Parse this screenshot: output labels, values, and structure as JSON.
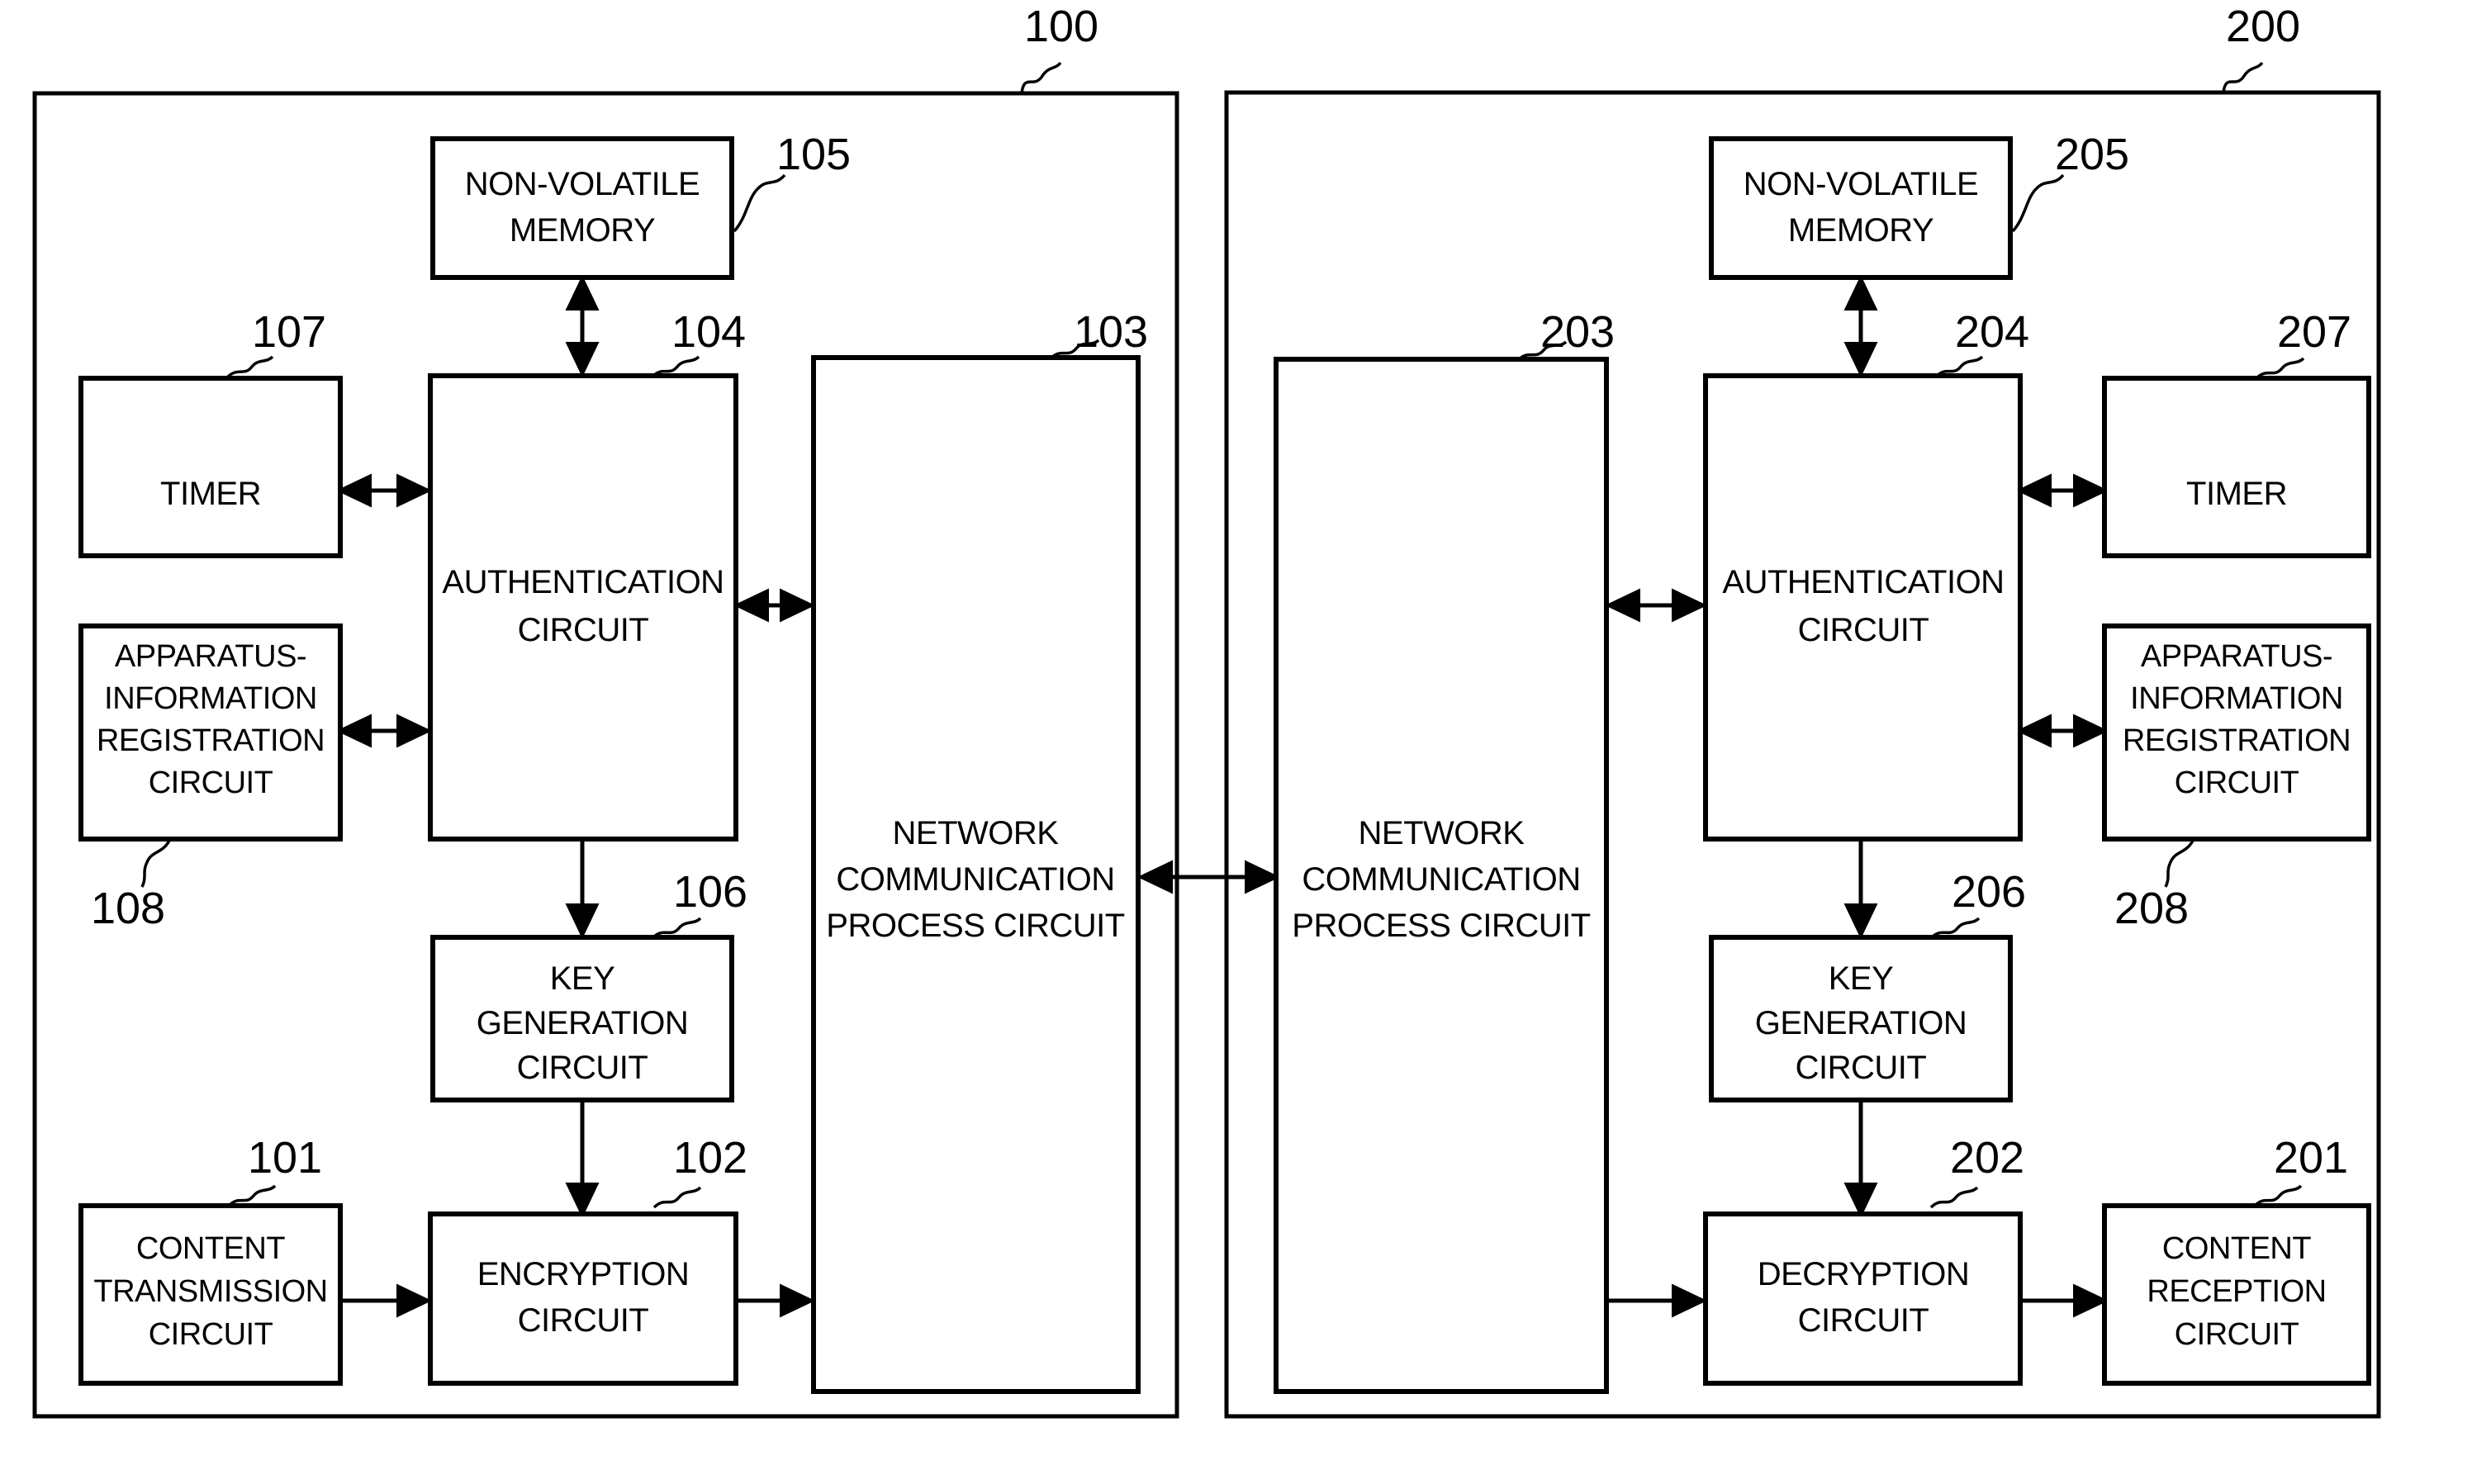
{
  "figure": {
    "type": "patent-block-diagram",
    "panels": [
      {
        "id": "transmitter-panel",
        "ref": "100",
        "blocks": [
          {
            "ref": "105",
            "label_lines": [
              "NON-VOLATILE",
              "MEMORY"
            ]
          },
          {
            "ref": "107",
            "label_lines": [
              "TIMER"
            ]
          },
          {
            "ref": "104",
            "label_lines": [
              "AUTHENTICATION",
              "CIRCUIT"
            ]
          },
          {
            "ref": "103",
            "label_lines": [
              "NETWORK",
              "COMMUNICATION",
              "PROCESS CIRCUIT"
            ]
          },
          {
            "ref": "108",
            "label_lines": [
              "APPARATUS-",
              "INFORMATION",
              "REGISTRATION",
              "CIRCUIT"
            ]
          },
          {
            "ref": "106",
            "label_lines": [
              "KEY",
              "GENERATION",
              "CIRCUIT"
            ]
          },
          {
            "ref": "101",
            "label_lines": [
              "CONTENT",
              "TRANSMISSION",
              "CIRCUIT"
            ]
          },
          {
            "ref": "102",
            "label_lines": [
              "ENCRYPTION",
              "CIRCUIT"
            ]
          }
        ]
      },
      {
        "id": "receiver-panel",
        "ref": "200",
        "blocks": [
          {
            "ref": "205",
            "label_lines": [
              "NON-VOLATILE",
              "MEMORY"
            ]
          },
          {
            "ref": "203",
            "label_lines": [
              "NETWORK",
              "COMMUNICATION",
              "PROCESS CIRCUIT"
            ]
          },
          {
            "ref": "204",
            "label_lines": [
              "AUTHENTICATION",
              "CIRCUIT"
            ]
          },
          {
            "ref": "207",
            "label_lines": [
              "TIMER"
            ]
          },
          {
            "ref": "208",
            "label_lines": [
              "APPARATUS-",
              "INFORMATION",
              "REGISTRATION",
              "CIRCUIT"
            ]
          },
          {
            "ref": "206",
            "label_lines": [
              "KEY",
              "GENERATION",
              "CIRCUIT"
            ]
          },
          {
            "ref": "202",
            "label_lines": [
              "DECRYPTION",
              "CIRCUIT"
            ]
          },
          {
            "ref": "201",
            "label_lines": [
              "CONTENT",
              "RECEPTION",
              "CIRCUIT"
            ]
          }
        ]
      }
    ],
    "colors": {
      "line": "#000000",
      "background": "#ffffff",
      "box_fill": "#ffffff"
    },
    "labels": {
      "non_volatile_memory_l1": "NON-VOLATILE",
      "non_volatile_memory_l2": "MEMORY",
      "timer": "TIMER",
      "authentication_l1": "AUTHENTICATION",
      "authentication_l2": "CIRCUIT",
      "network_l1": "NETWORK",
      "network_l2": "COMMUNICATION",
      "network_l3": "PROCESS CIRCUIT",
      "apparatus_l1": "APPARATUS-",
      "apparatus_l2": "INFORMATION",
      "apparatus_l3": "REGISTRATION",
      "apparatus_l4": "CIRCUIT",
      "key_gen_l1": "KEY",
      "key_gen_l2": "GENERATION",
      "key_gen_l3": "CIRCUIT",
      "content_tx_l1": "CONTENT",
      "content_tx_l2": "TRANSMISSION",
      "content_tx_l3": "CIRCUIT",
      "encryption_l1": "ENCRYPTION",
      "encryption_l2": "CIRCUIT",
      "decryption_l1": "DECRYPTION",
      "decryption_l2": "CIRCUIT",
      "content_rx_l1": "CONTENT",
      "content_rx_l2": "RECEPTION",
      "content_rx_l3": "CIRCUIT"
    },
    "refs": {
      "r100": "100",
      "r101": "101",
      "r102": "102",
      "r103": "103",
      "r104": "104",
      "r105": "105",
      "r106": "106",
      "r107": "107",
      "r108": "108",
      "r200": "200",
      "r201": "201",
      "r202": "202",
      "r203": "203",
      "r204": "204",
      "r205": "205",
      "r206": "206",
      "r207": "207",
      "r208": "208"
    }
  }
}
